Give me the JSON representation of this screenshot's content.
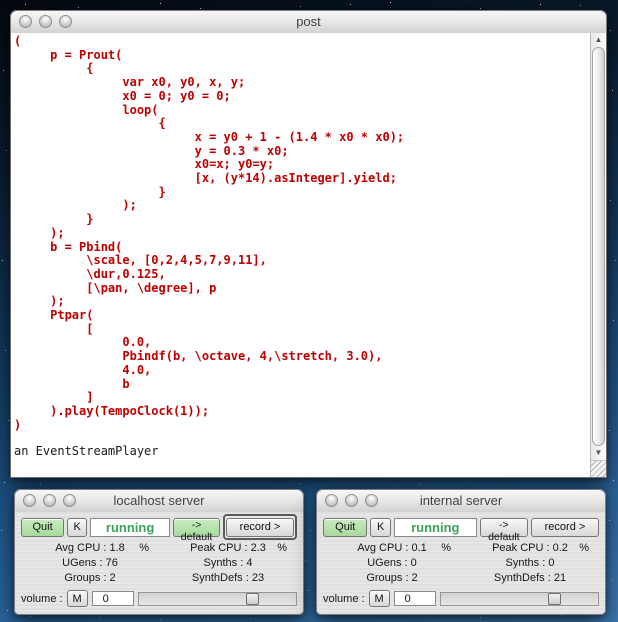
{
  "icons": {
    "scroll_up": "▲",
    "scroll_down": "▼"
  },
  "colors": {
    "code_red": "#c00000",
    "button_green": "#aedaa3",
    "status_green": "#3aa45a",
    "desktop_blue_top": "#0a1c30",
    "desktop_blue_bottom": "#3d7ab2"
  },
  "post_window": {
    "title": "post",
    "code": "(\n\tp = Prout(\n\t\t{\n\t\t\tvar x0, y0, x, y;\n\t\t\tx0 = 0; y0 = 0;\n\t\t\tloop(\n\t\t\t\t{\n\t\t\t\t\tx = y0 + 1 - (1.4 * x0 * x0);\n\t\t\t\t\ty = 0.3 * x0;\n\t\t\t\t\tx0=x; y0=y;\n\t\t\t\t\t[x, (y*14).asInteger].yield;\n\t\t\t\t}\n\t\t\t);\n\t\t}\n\t);\n\tb = Pbind(\n\t\t\\scale, [0,2,4,5,7,9,11],\n\t\t\\dur,0.125,\n\t\t[\\pan, \\degree], p\n\t);\n\tPtpar(\n\t\t[\n\t\t\t0.0,\n\t\t\tPbindf(b, \\octave, 4,\\stretch, 3.0),\n\t\t\t4.0,\n\t\t\tb\n\t\t]\n\t).play(TempoClock(1));\n)",
    "result": "an EventStreamPlayer"
  },
  "servers": [
    {
      "title": "localhost server",
      "buttons": {
        "quit": "Quit",
        "k": "K",
        "default": "-> default",
        "record": "record >"
      },
      "status": "running",
      "stats": {
        "avg_cpu": "Avg CPU : 1.8",
        "avg_pct": "%",
        "peak_cpu": "Peak CPU : 2.3",
        "peak_pct": "%",
        "ugens": "UGens : 76",
        "synths": "Synths : 4",
        "groups": "Groups : 2",
        "synthdefs": "SynthDefs : 23"
      },
      "volume": {
        "label": "volume :",
        "mute": "M",
        "value": "0"
      }
    },
    {
      "title": "internal server",
      "buttons": {
        "quit": "Quit",
        "k": "K",
        "default": "-> default",
        "record": "record >"
      },
      "status": "running",
      "stats": {
        "avg_cpu": "Avg CPU : 0.1",
        "avg_pct": "%",
        "peak_cpu": "Peak CPU : 0.2",
        "peak_pct": "%",
        "ugens": "UGens : 0",
        "synths": "Synths : 0",
        "groups": "Groups : 2",
        "synthdefs": "SynthDefs : 21"
      },
      "volume": {
        "label": "volume :",
        "mute": "M",
        "value": "0"
      }
    }
  ]
}
